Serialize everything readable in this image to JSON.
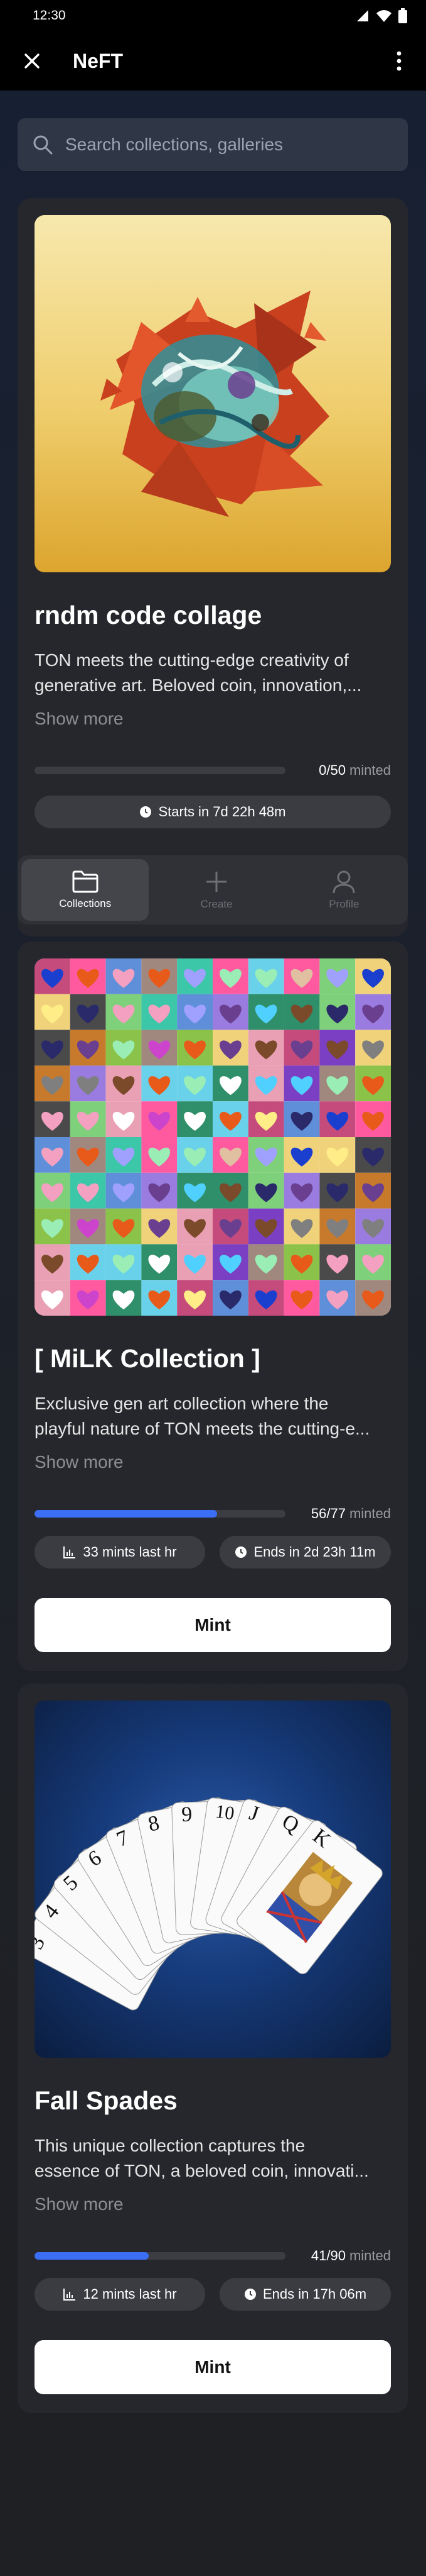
{
  "status_bar": {
    "time": "12:30"
  },
  "app_bar": {
    "title": "NeFT"
  },
  "search": {
    "placeholder": "Search collections, galleries"
  },
  "collections": [
    {
      "title": "rndm code collage",
      "description_lines": [
        "TON meets the cutting-edge creativity of",
        "generative art. Beloved coin, innovation,..."
      ],
      "show_more": "Show more",
      "minted_count": "0/50",
      "minted_label": "minted",
      "progress": 0,
      "timer": "Starts in 7d 22h 48m"
    },
    {
      "title": "[ MiLK Collection ]",
      "description_lines": [
        "Exclusive gen art collection where the",
        "playful nature of TON meets the cutting-e..."
      ],
      "show_more": "Show more",
      "minted_count": "56/77",
      "minted_label": "minted",
      "progress": 0.727,
      "rate": "33 mints last hr",
      "timer": "Ends in 2d 23h 11m",
      "mint_label": "Mint"
    },
    {
      "title": "Fall Spades",
      "description_lines": [
        "This unique collection captures the",
        "essence of TON, a beloved coin, innovati..."
      ],
      "show_more": "Show more",
      "minted_count": "41/90",
      "minted_label": "minted",
      "progress": 0.456,
      "rate": "12 mints last hr",
      "timer": "Ends in 17h 06m",
      "mint_label": "Mint",
      "card_ranks": [
        "9",
        "10",
        "J",
        "Q",
        "K"
      ]
    }
  ],
  "tabs": [
    {
      "label": "Collections",
      "icon": "folder-icon",
      "active": true
    },
    {
      "label": "Create",
      "icon": "plus-icon",
      "active": false
    },
    {
      "label": "Profile",
      "icon": "person-icon",
      "active": false
    }
  ],
  "colors": {
    "accent": "#3b6ef5",
    "background": "#1c1c1e",
    "card": "#25272c",
    "art1_top": "#f6e6a6",
    "art1_bottom": "#dca52e"
  }
}
